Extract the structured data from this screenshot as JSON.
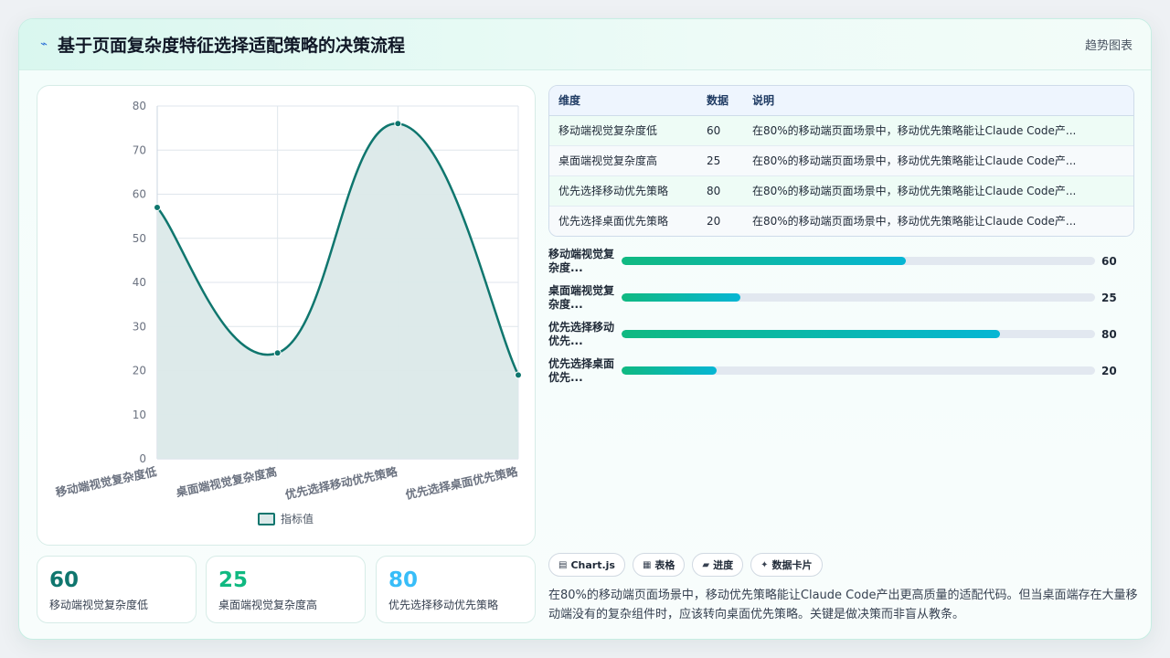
{
  "header": {
    "title": "基于页面复杂度特征选择适配策略的决策流程",
    "badge": "趋势图表",
    "icon": "bolt-icon"
  },
  "chart_data": {
    "type": "area",
    "categories": [
      "移动端视觉复杂度低",
      "桌面端视觉复杂度高",
      "优先选择移动优先策略",
      "优先选择桌面优先策略"
    ],
    "series": [
      {
        "name": "指标值",
        "values": [
          57,
          24,
          76,
          19
        ]
      }
    ],
    "ylim": [
      0,
      80
    ],
    "yticks": [
      0,
      10,
      20,
      30,
      40,
      50,
      60,
      70,
      80
    ],
    "grid": true,
    "legend": "bottom",
    "line_color": "#0f766e",
    "fill_color": "#dbe9e9"
  },
  "stats": [
    {
      "value": "60",
      "label": "移动端视觉复杂度低",
      "color": "#0f766e"
    },
    {
      "value": "25",
      "label": "桌面端视觉复杂度高",
      "color": "#10b981"
    },
    {
      "value": "80",
      "label": "优先选择移动优先策略",
      "color": "#38bdf8"
    }
  ],
  "table": {
    "headers": [
      "维度",
      "数据",
      "说明"
    ],
    "rows": [
      [
        "移动端视觉复杂度低",
        "60",
        "在80%的移动端页面场景中，移动优先策略能让Claude Code产..."
      ],
      [
        "桌面端视觉复杂度高",
        "25",
        "在80%的移动端页面场景中，移动优先策略能让Claude Code产..."
      ],
      [
        "优先选择移动优先策略",
        "80",
        "在80%的移动端页面场景中，移动优先策略能让Claude Code产..."
      ],
      [
        "优先选择桌面优先策略",
        "20",
        "在80%的移动端页面场景中，移动优先策略能让Claude Code产..."
      ]
    ]
  },
  "progress": [
    {
      "label_line1": "移动端视觉复",
      "label_line2": "杂度...",
      "value": 60,
      "value_text": "60"
    },
    {
      "label_line1": "桌面端视觉复",
      "label_line2": "杂度...",
      "value": 25,
      "value_text": "25"
    },
    {
      "label_line1": "优先选择移动",
      "label_line2": "优先...",
      "value": 80,
      "value_text": "80"
    },
    {
      "label_line1": "优先选择桌面",
      "label_line2": "优先...",
      "value": 20,
      "value_text": "20"
    }
  ],
  "chips": [
    {
      "icon": "chart-icon",
      "glyph": "▤",
      "label": "Chart.js"
    },
    {
      "icon": "table-icon",
      "glyph": "▦",
      "label": "表格"
    },
    {
      "icon": "progress-icon",
      "glyph": "▰",
      "label": "进度"
    },
    {
      "icon": "sparkle-icon",
      "glyph": "✦",
      "label": "数据卡片"
    }
  ],
  "description": "在80%的移动端页面场景中，移动优先策略能让Claude Code产出更高质量的适配代码。但当桌面端存在大量移动端没有的复杂组件时，应该转向桌面优先策略。关键是做决策而非盲从教条。"
}
